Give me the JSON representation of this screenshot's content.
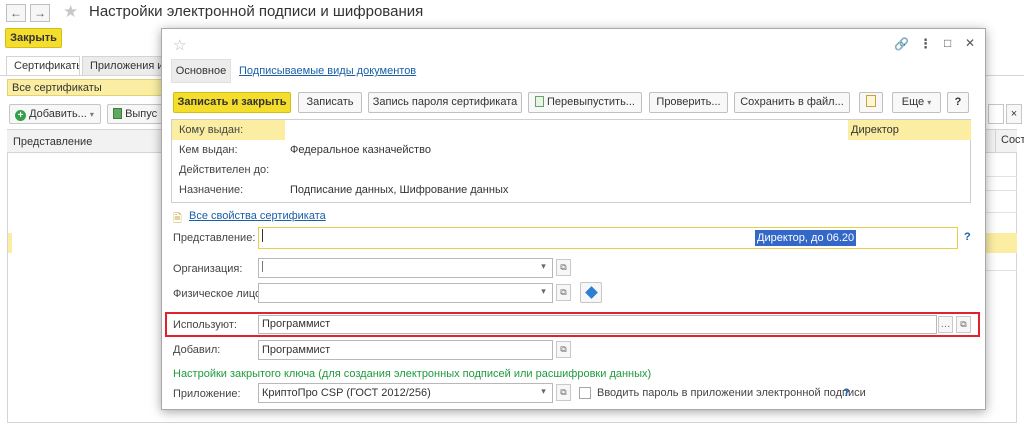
{
  "window": {
    "back_icon": "←",
    "forward_icon": "→",
    "title": "Настройки электронной подписи и шифрования",
    "close_button": "Закрыть"
  },
  "tabs": [
    {
      "label": "Сертификаты"
    },
    {
      "label": "Приложения и т"
    }
  ],
  "certificates": {
    "group_label": "Все сертификаты",
    "add_button": "Добавить...",
    "issue_button": "Выпус",
    "column_presentation": "Представление",
    "column_status": "Сост",
    "search_clear": "×"
  },
  "dialog": {
    "tabs": [
      {
        "label": "Основное"
      },
      {
        "label": "Подписываемые виды документов"
      }
    ],
    "window_buttons": {
      "link": "🔗",
      "more": "⋮",
      "maximize": "□",
      "close": "✕"
    },
    "toolbar": {
      "save_close": "Записать и закрыть",
      "save": "Записать",
      "save_password": "Запись пароля сертификата",
      "reissue": "Перевыпустить...",
      "check": "Проверить...",
      "save_to_file": "Сохранить в файл...",
      "more": "Еще",
      "help": "?"
    },
    "cert_info": {
      "issued_to_label": "Кому выдан:",
      "issued_to_value": "Директор",
      "issued_by_label": "Кем выдан:",
      "issued_by_value": "Федеральное казначейство",
      "valid_to_label": "Действителен до:",
      "valid_to_value": "",
      "purpose_label": "Назначение:",
      "purpose_value": "Подписание данных, Шифрование данных"
    },
    "all_properties_link": "Все свойства сертификата",
    "presentation_label": "Представление:",
    "presentation_value": "Директор, до 06.20",
    "organization_label": "Организация:",
    "organization_value": "",
    "person_label": "Физическое лицо:",
    "person_value": "",
    "users_label": "Используют:",
    "users_value": "Программист",
    "added_by_label": "Добавил:",
    "added_by_value": "Программист",
    "private_key_header": "Настройки закрытого ключа (для создания электронных подписей или расшифровки данных)",
    "application_label": "Приложение:",
    "application_value": "КриптоПро CSP (ГОСТ 2012/256)",
    "enter_password_label": "Вводить пароль в приложении электронной подписи",
    "help_mark": "?"
  },
  "colors": {
    "accent_yellow": "#f5dd2b",
    "highlight_row": "#fbeea3",
    "link_blue": "#1a5fa8",
    "section_green": "#1e9a3e",
    "callout_red": "#e0222e"
  }
}
